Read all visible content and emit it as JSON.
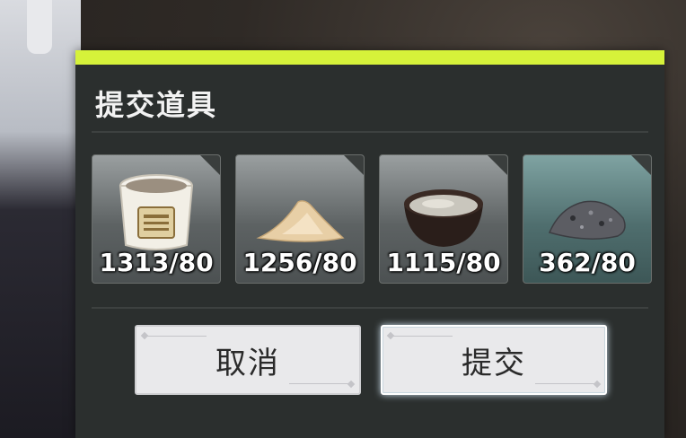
{
  "dialog": {
    "title": "提交道具",
    "accent_color": "#d6f23a",
    "items": [
      {
        "icon": "paint-bucket-icon",
        "count": "1313/80"
      },
      {
        "icon": "sand-pile-icon",
        "count": "1256/80"
      },
      {
        "icon": "liquid-bowl-icon",
        "count": "1115/80"
      },
      {
        "icon": "ore-pile-icon",
        "count": "362/80"
      }
    ],
    "cancel_label": "取消",
    "submit_label": "提交"
  }
}
